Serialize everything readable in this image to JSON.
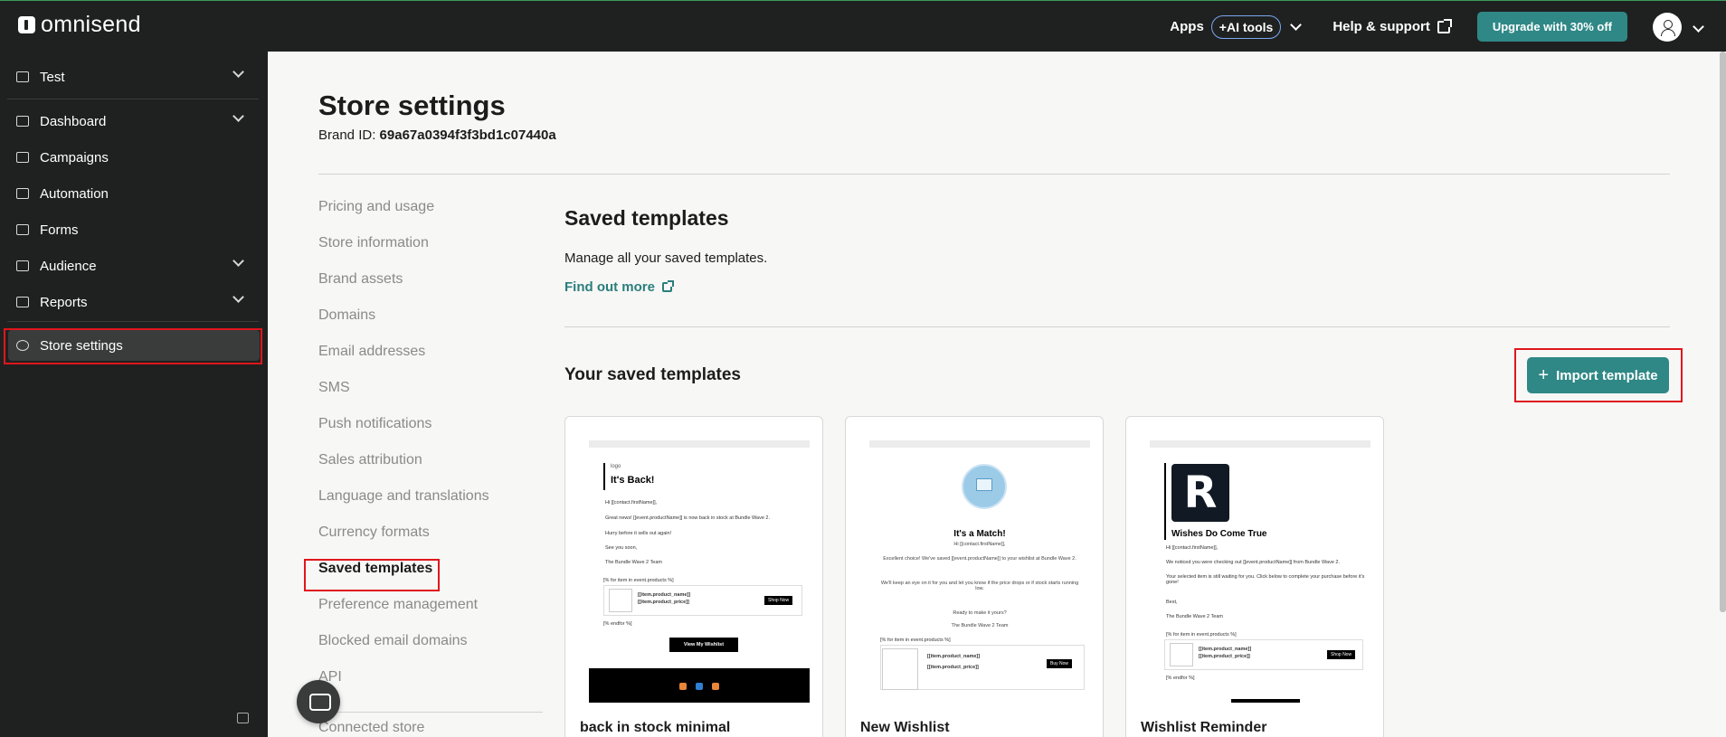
{
  "app": {
    "logo_text": "omnisend"
  },
  "topbar": {
    "apps_label": "Apps",
    "ai_tools_label": "+AI tools",
    "help_label": "Help & support",
    "upgrade_label": "Upgrade with 30% off"
  },
  "sidebar": {
    "store_name": "Test",
    "items": [
      {
        "label": "Dashboard"
      },
      {
        "label": "Campaigns"
      },
      {
        "label": "Automation"
      },
      {
        "label": "Forms"
      },
      {
        "label": "Audience"
      },
      {
        "label": "Reports"
      },
      {
        "label": "Store settings"
      }
    ]
  },
  "page": {
    "title": "Store settings",
    "brand_id_label": "Brand ID:",
    "brand_id_value": "69a67a0394f3f3bd1c07440a"
  },
  "subnav": {
    "items": [
      "Pricing and usage",
      "Store information",
      "Brand assets",
      "Domains",
      "Email addresses",
      "SMS",
      "Push notifications",
      "Sales attribution",
      "Language and translations",
      "Currency formats",
      "Saved templates",
      "Preference management",
      "Blocked email domains",
      "API",
      "Connected store"
    ],
    "active": "Saved templates"
  },
  "section": {
    "title": "Saved templates",
    "description": "Manage all your saved templates.",
    "find_out_more": "Find out more",
    "saved_heading": "Your saved templates",
    "import_button": "Import template"
  },
  "templates": [
    {
      "name": "back in stock minimal",
      "preview": {
        "logo_alt": "logo",
        "title": "It's Back!",
        "lines": [
          "Hi [[contact.firstName]],",
          "Great news! [[event.productName]] is now back in stock at Bundle Wave 2.",
          "Hurry before it sells out again!",
          "See you soon,",
          "The Bundle Wave 2 Team",
          "[% for item in event.products %]"
        ],
        "product_name": "[[item.product_name]]",
        "product_price": "[[item.product_price]]",
        "shop_now": "Shop Now",
        "endfor": "[% endfor %]",
        "cta": "View My Wishlist"
      }
    },
    {
      "name": "New Wishlist",
      "preview": {
        "title": "It's a Match!",
        "lines": [
          "Hi [[contact.firstName]],",
          "Excellent choice! We've saved [[event.productName]] to your wishlist at Bundle Wave 2.",
          "We'll keep an eye on it for you and let you know if the price drops or if stock starts running low.",
          "Ready to make it yours?",
          "The Bundle Wave 2 Team",
          "[% for item in event.products %]"
        ],
        "product_name": "[[item.product_name]]",
        "product_price": "[[item.product_price]]",
        "buy_now": "Buy Now"
      }
    },
    {
      "name": "Wishlist Reminder",
      "preview": {
        "logo_letter": "R",
        "title": "Wishes Do Come True",
        "lines": [
          "Hi [[contact.firstName]],",
          "We noticed you were checking out [[event.productName]] from Bundle Wave 2.",
          "Your selected item is still waiting for you. Click below to complete your purchase before it's gone!",
          "Best,",
          "The Bundle Wave 2 Team",
          "[% for item in event.products %]"
        ],
        "product_name": "[[item.product_name]]",
        "product_price": "[[item.product_price]]",
        "shop_now": "Shop Now",
        "endfor": "[% endfor %]"
      }
    }
  ],
  "colors": {
    "sidebar_bg": "#1f2121",
    "accent": "#2f8886",
    "highlight": "#e0161c"
  }
}
